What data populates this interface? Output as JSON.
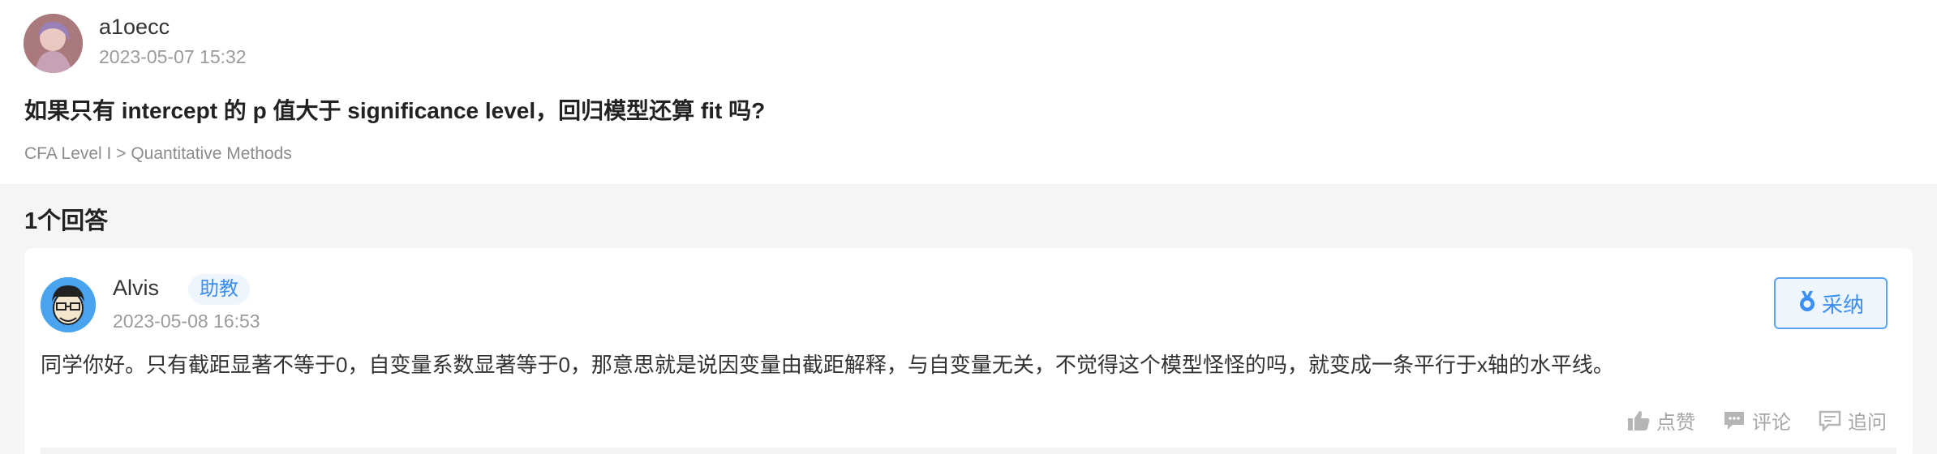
{
  "question": {
    "username": "a1oecc",
    "timestamp": "2023-05-07 15:32",
    "title": "如果只有 intercept 的 p 值大于 significance level，回归模型还算 fit 吗?",
    "breadcrumb": "CFA Level I > Quantitative Methods"
  },
  "answers": {
    "count_label": "1个回答",
    "items": [
      {
        "username": "Alvis",
        "role_badge": "助教",
        "timestamp": "2023-05-08 16:53",
        "accept_label": "采纳",
        "content": "同学你好。只有截距显著不等于0，自变量系数显著等于0，那意思就是说因变量由截距解释，与自变量无关，不觉得这个模型怪怪的吗，就变成一条平行于x轴的水平线。",
        "actions": {
          "like": "点赞",
          "comment": "评论",
          "follow_up": "追问"
        }
      }
    ]
  },
  "colors": {
    "accent": "#3b8ff2",
    "page_bg": "#f5f5f5",
    "muted": "#9b9b9b"
  }
}
